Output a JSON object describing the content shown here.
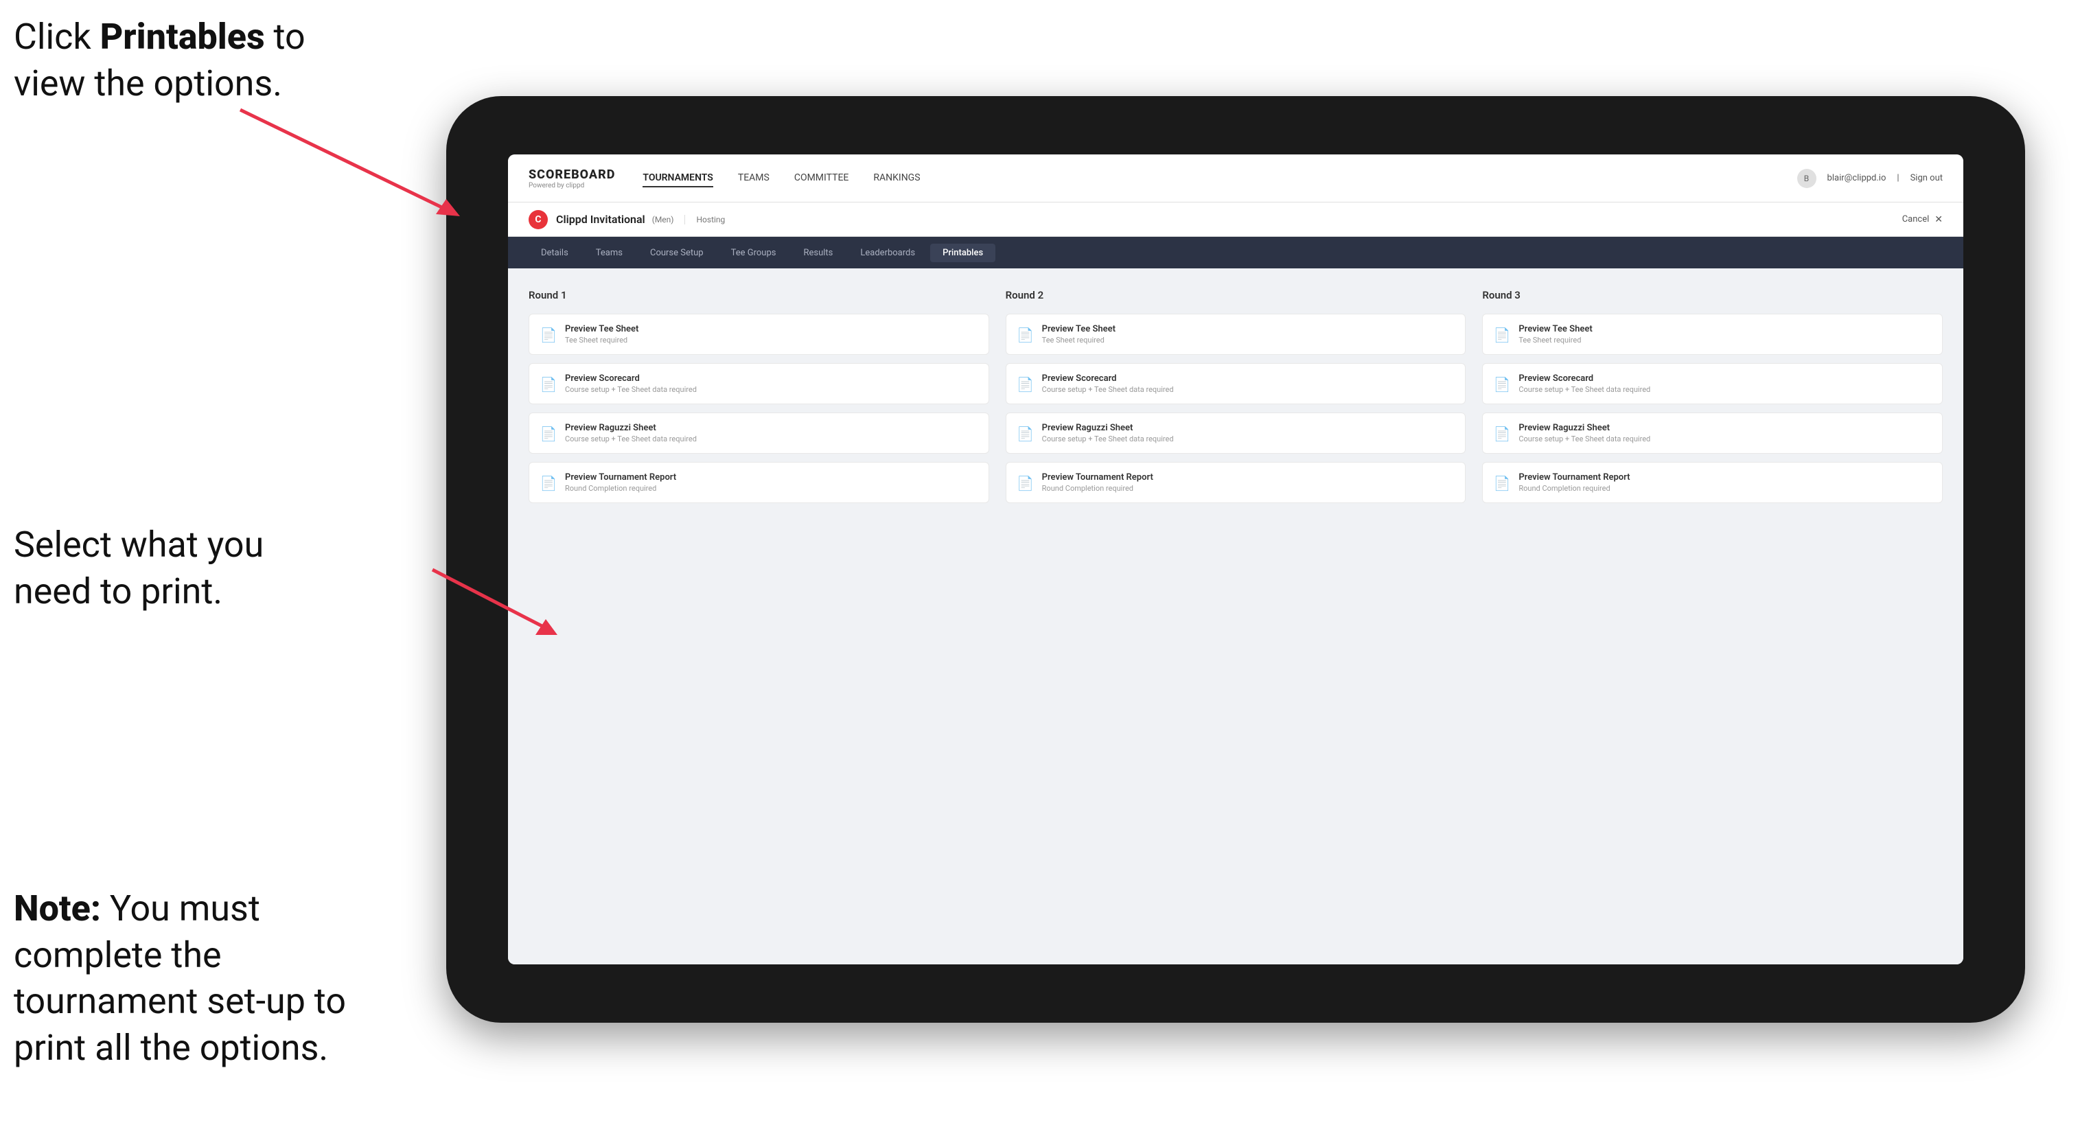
{
  "annotations": {
    "top_line1": "Click ",
    "top_bold": "Printables",
    "top_line2": " to",
    "top_line3": "view the options.",
    "middle_line1": "Select what you",
    "middle_line2": "need to print.",
    "bottom_note_bold": "Note:",
    "bottom_note": " You must complete the tournament set-up to print all the options."
  },
  "top_nav": {
    "logo_title": "SCOREBOARD",
    "logo_sub": "Powered by clippd",
    "items": [
      {
        "label": "TOURNAMENTS",
        "active": false
      },
      {
        "label": "TEAMS",
        "active": false
      },
      {
        "label": "COMMITTEE",
        "active": false
      },
      {
        "label": "RANKINGS",
        "active": false
      }
    ],
    "user_email": "blair@clippd.io",
    "sign_out": "Sign out"
  },
  "sub_header": {
    "logo_letter": "C",
    "tournament_name": "Clippd Invitational",
    "tournament_badge": "(Men)",
    "tournament_status": "Hosting",
    "cancel": "Cancel",
    "close": "✕"
  },
  "tabs": [
    {
      "label": "Details",
      "active": false
    },
    {
      "label": "Teams",
      "active": false
    },
    {
      "label": "Course Setup",
      "active": false
    },
    {
      "label": "Tee Groups",
      "active": false
    },
    {
      "label": "Results",
      "active": false
    },
    {
      "label": "Leaderboards",
      "active": false
    },
    {
      "label": "Printables",
      "active": true
    }
  ],
  "rounds": [
    {
      "title": "Round 1",
      "cards": [
        {
          "title": "Preview Tee Sheet",
          "subtitle": "Tee Sheet required"
        },
        {
          "title": "Preview Scorecard",
          "subtitle": "Course setup + Tee Sheet data required"
        },
        {
          "title": "Preview Raguzzi Sheet",
          "subtitle": "Course setup + Tee Sheet data required"
        },
        {
          "title": "Preview Tournament Report",
          "subtitle": "Round Completion required"
        }
      ]
    },
    {
      "title": "Round 2",
      "cards": [
        {
          "title": "Preview Tee Sheet",
          "subtitle": "Tee Sheet required"
        },
        {
          "title": "Preview Scorecard",
          "subtitle": "Course setup + Tee Sheet data required"
        },
        {
          "title": "Preview Raguzzi Sheet",
          "subtitle": "Course setup + Tee Sheet data required"
        },
        {
          "title": "Preview Tournament Report",
          "subtitle": "Round Completion required"
        }
      ]
    },
    {
      "title": "Round 3",
      "cards": [
        {
          "title": "Preview Tee Sheet",
          "subtitle": "Tee Sheet required"
        },
        {
          "title": "Preview Scorecard",
          "subtitle": "Course setup + Tee Sheet data required"
        },
        {
          "title": "Preview Raguzzi Sheet",
          "subtitle": "Course setup + Tee Sheet data required"
        },
        {
          "title": "Preview Tournament Report",
          "subtitle": "Round Completion required"
        }
      ]
    }
  ],
  "icons": {
    "document": "📄",
    "user": "👤"
  }
}
